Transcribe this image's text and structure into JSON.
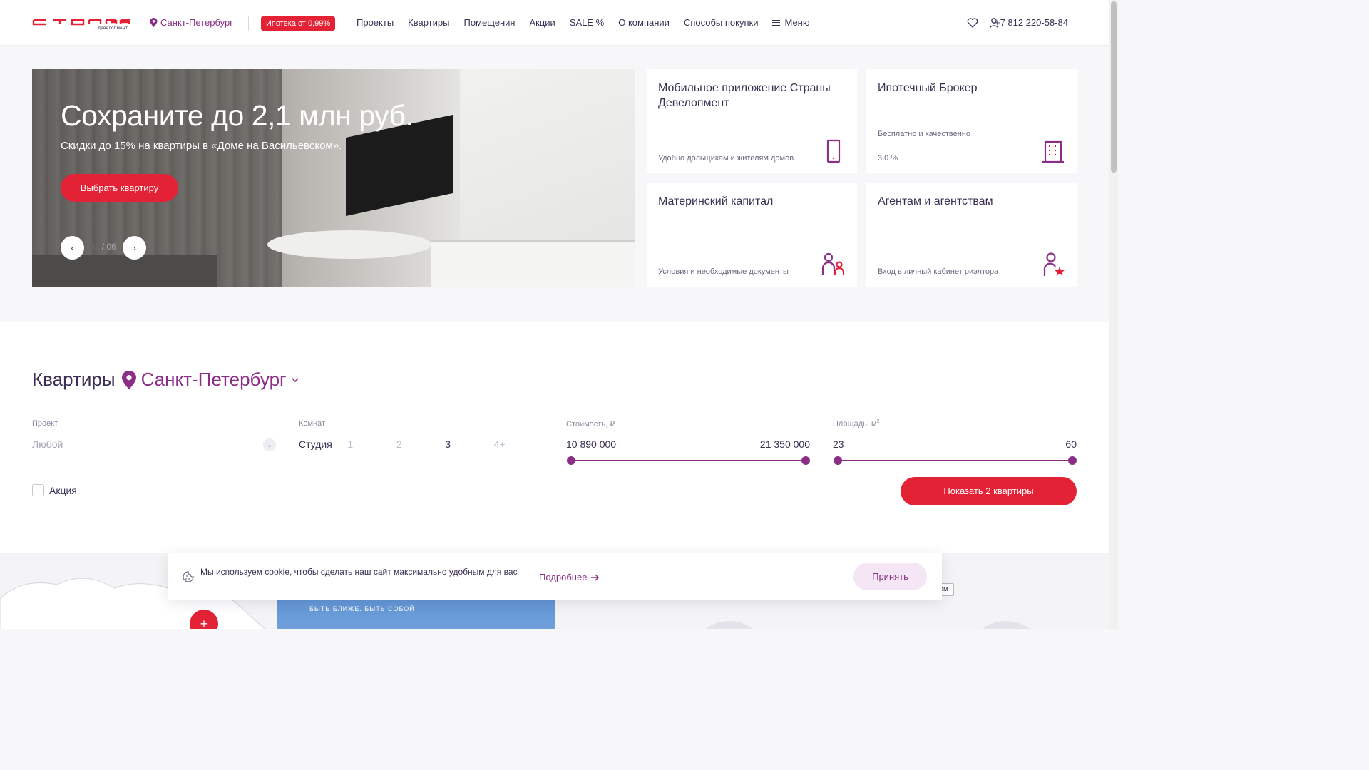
{
  "header": {
    "city": "Санкт-Петербург",
    "mortgage_badge": "Ипотека от 0,99%",
    "nav": [
      "Проекты",
      "Квартиры",
      "Помещения",
      "Акции",
      "SALE %",
      "О компании",
      "Способы покупки"
    ],
    "menu_label": "Меню",
    "phone": "+7 812 220-58-84",
    "logo_text": "СТРАНА девелопмент"
  },
  "hero": {
    "title": "Сохраните до 2,1 млн руб.",
    "subtitle": "Скидки до 15% на квартиры в «Доме на Васильевском».",
    "cta": "Выбрать квартиру",
    "current": "02",
    "sep": "/",
    "total": "06"
  },
  "cards": [
    {
      "title": "Мобильное приложение Страны Девелопмент",
      "line1": "",
      "desc": "Удобно дольщикам и жителям домов",
      "icon": "phone-icon"
    },
    {
      "title": "Ипотечный Брокер",
      "line1": "Бесплатно и качественно",
      "desc": "3.0 %",
      "icon": "building-icon"
    },
    {
      "title": "Материнский капитал",
      "line1": "",
      "desc": "Условия и необходимые документы",
      "icon": "family-icon"
    },
    {
      "title": "Агентам и агентствам",
      "line1": "",
      "desc": "Вход в личный кабинет риэлтора",
      "icon": "agent-star-icon"
    }
  ],
  "filter": {
    "heading": "Квартиры",
    "city": "Санкт-Петербург",
    "project_label": "Проект",
    "project_value": "Любой",
    "rooms_label": "Комнат",
    "rooms": [
      {
        "label": "Студия",
        "active": true
      },
      {
        "label": "1",
        "active": false
      },
      {
        "label": "2",
        "active": false
      },
      {
        "label": "3",
        "active": true
      },
      {
        "label": "4+",
        "active": false
      }
    ],
    "price_label": "Стоимость, ₽",
    "price_min": "10 890 000",
    "price_max": "21 350 000",
    "area_label": "Площадь, м",
    "area_sup": "2",
    "area_min": "23",
    "area_max": "60",
    "promo_label": "Акция",
    "show_button": "Показать 2 квартиры"
  },
  "bottom": {
    "slogan": "БЫТЬ БЛИЖЕ. БЫТЬ СОБОЙ",
    "chip": "ском",
    "plus": "+"
  },
  "cookie": {
    "text": "Мы используем cookie, чтобы сделать наш сайт максимально удобным для вас",
    "more": "Подробнее",
    "accept": "Принять"
  },
  "colors": {
    "brand_red": "#e32235",
    "brand_purple": "#8b2f86",
    "text_dark": "#3b3054"
  }
}
